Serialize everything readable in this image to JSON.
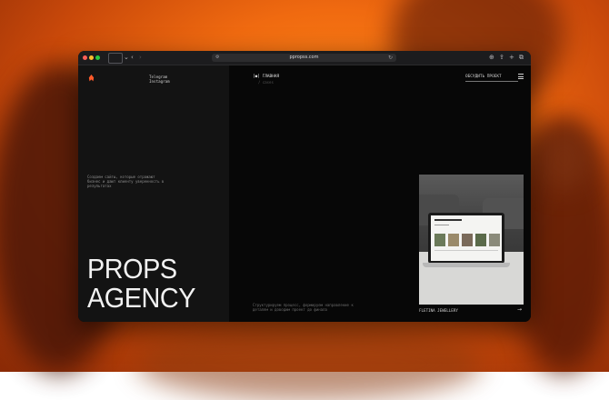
{
  "browser": {
    "url": "ppropss.com"
  },
  "site": {
    "social_links": [
      "Telegram",
      "Instagram"
    ],
    "nav": {
      "main": "[●] ГЛАВНАЯ",
      "sub": "/ cases"
    },
    "discuss_label": "ОБСУДИТЬ ПРОЕКТ",
    "tagline": "Создаем сайты, которые отражают бизнес и дают клиенту уверенность в результатах",
    "headline_line1": "PROPS",
    "headline_line2": "AGENCY",
    "bottom_text": "Структурируем процесс, формируем направление к деталям и доводим проект до финала",
    "card_caption": "FLETINA JEWELLERY",
    "card_arrow": "→"
  },
  "colors": {
    "accent": "#ff5a2a",
    "page_bg": "#070707",
    "panel_bg": "#131313",
    "text": "#f2f2f2"
  }
}
